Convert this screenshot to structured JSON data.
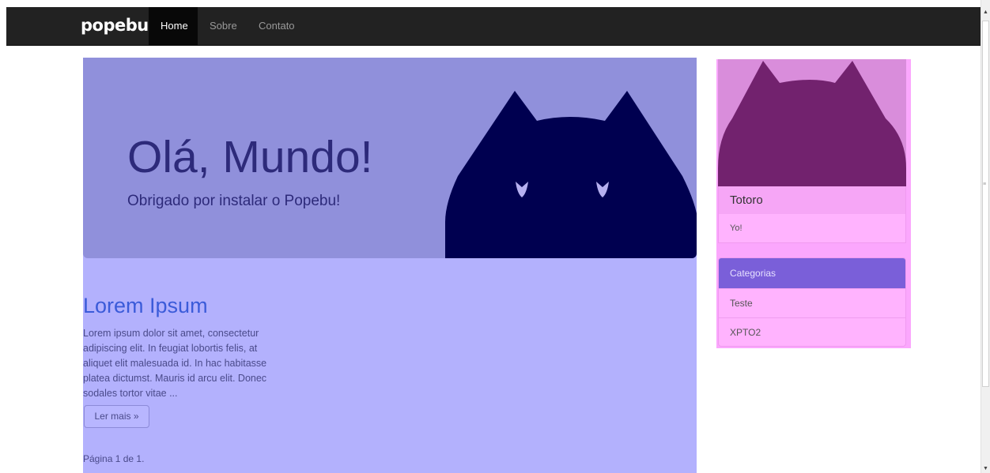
{
  "navbar": {
    "brand": "popebu",
    "items": [
      {
        "label": "Home",
        "active": true
      },
      {
        "label": "Sobre",
        "active": false
      },
      {
        "label": "Contato",
        "active": false
      }
    ]
  },
  "hero": {
    "title": "Olá, Mundo!",
    "subtitle": "Obrigado por instalar o Popebu!"
  },
  "post": {
    "title": "Lorem Ipsum",
    "excerpt": "Lorem ipsum dolor sit amet, consectetur adipiscing elit. In feugiat lobortis felis, at aliquet elit malesuada id. In hac habitasse platea dictumst. Mauris id arcu elit. Donec sodales tortor vitae ...",
    "more_label": "Ler mais »"
  },
  "pagination": "Página 1 de 1.",
  "sidebar": {
    "profile": {
      "name": "Totoro",
      "text": "Yo!"
    },
    "categories": {
      "header": "Categorias",
      "items": [
        "Teste",
        "XPTO2"
      ]
    }
  },
  "colors": {
    "navbar_bg": "#222222",
    "hero_bg": "#9090db",
    "main_bg": "#b3b1fd",
    "cat_silhouette": "#000050",
    "sidebar_bg": "#fba7fd",
    "profile_art_bg": "#d98ddb",
    "profile_cat": "#72226e",
    "categories_header": "#7a5fd9",
    "post_title": "#3b5bd9"
  }
}
